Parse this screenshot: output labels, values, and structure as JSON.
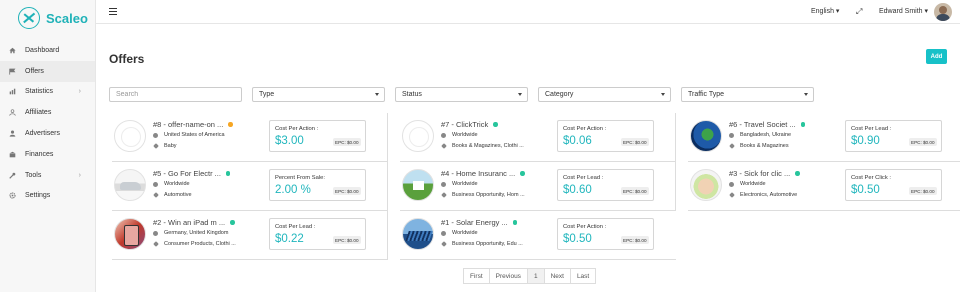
{
  "app": {
    "logo_text": "Scaleo"
  },
  "sidebar": {
    "items": [
      {
        "label": "Dashboard",
        "icon": "home-icon"
      },
      {
        "label": "Offers",
        "icon": "flag-icon"
      },
      {
        "label": "Statistics",
        "icon": "chart-icon"
      },
      {
        "label": "Affiliates",
        "icon": "affiliates-icon"
      },
      {
        "label": "Advertisers",
        "icon": "user-icon"
      },
      {
        "label": "Finances",
        "icon": "building-icon"
      },
      {
        "label": "Tools",
        "icon": "wrench-icon"
      },
      {
        "label": "Settings",
        "icon": "gear-icon"
      }
    ]
  },
  "header": {
    "language": "English",
    "user_name": "Edward Smith"
  },
  "page": {
    "title": "Offers",
    "add_label": "Add"
  },
  "filters": {
    "search_placeholder": "Search",
    "type": "Type",
    "status": "Status",
    "category": "Category",
    "traffic_type": "Traffic Type"
  },
  "offers": [
    {
      "title": "#8 - offer-name-on ...",
      "status": "orange",
      "geo": "United States of America",
      "category": "Baby",
      "price_label": "Cost Per Action :",
      "price": "$3.00",
      "epc": "EPC: $0.00",
      "image": "sun"
    },
    {
      "title": "#7 - ClickTrick",
      "status": "green",
      "geo": "Worldwide",
      "category": "Books & Magazines, Clothi ...",
      "price_label": "Cost Per Action :",
      "price": "$0.06",
      "epc": "EPC: $0.00",
      "image": "sun"
    },
    {
      "title": "#6 - Travel Societ ...",
      "status": "green",
      "geo": "Bangladesh, Ukraine",
      "category": "Books & Magazines",
      "price_label": "Cost Per Lead :",
      "price": "$0.90",
      "epc": "EPC: $0.00",
      "image": "globe"
    },
    {
      "title": "#5 - Go For Electr ...",
      "status": "green",
      "geo": "Worldwide",
      "category": "Automotive",
      "price_label": "Percent From Sale:",
      "price": "2.00 %",
      "epc": "EPC: $0.00",
      "image": "car"
    },
    {
      "title": "#4 - Home Insuranc ...",
      "status": "green",
      "geo": "Worldwide",
      "category": "Business Opportunity, Hom ...",
      "price_label": "Cost Per Lead :",
      "price": "$0.60",
      "epc": "EPC: $0.00",
      "image": "house"
    },
    {
      "title": "#3 - Sick for clic ...",
      "status": "green",
      "geo": "Worldwide",
      "category": "Electronics, Automotive",
      "price_label": "Cost Per Click :",
      "price": "$0.50",
      "epc": "EPC: $0.00",
      "image": "sick"
    },
    {
      "title": "#2 - Win an iPad m ...",
      "status": "green",
      "geo": "Germany, United Kingdom",
      "category": "Consumer Products, Clothi ...",
      "price_label": "Cost Per Lead :",
      "price": "$0.22",
      "epc": "EPC: $0.00",
      "image": "ipad"
    },
    {
      "title": "#1 - Solar Energy ...",
      "status": "green",
      "geo": "Worldwide",
      "category": "Business Opportunity, Edu ...",
      "price_label": "Cost Per Action :",
      "price": "$0.50",
      "epc": "EPC: $0.00",
      "image": "solar"
    }
  ],
  "pagination": {
    "first": "First",
    "previous": "Previous",
    "current": "1",
    "next": "Next",
    "last": "Last"
  }
}
